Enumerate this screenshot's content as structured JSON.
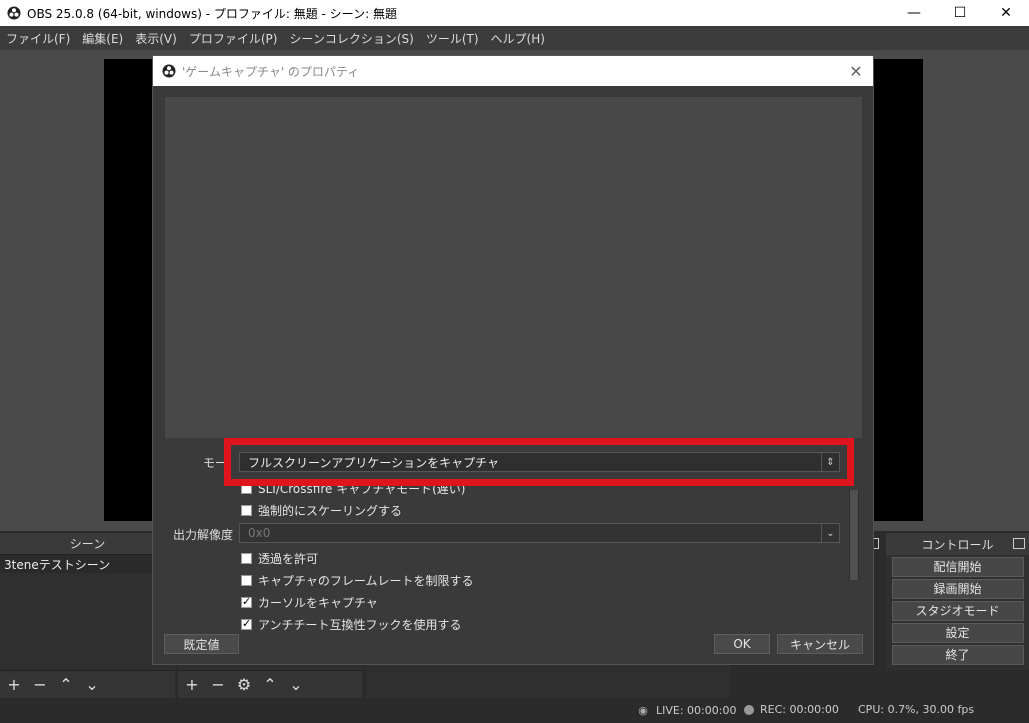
{
  "window": {
    "title": "OBS 25.0.8 (64-bit, windows) - プロファイル: 無題 - シーン: 無題",
    "minimize": "—",
    "maximize": "☐",
    "close": "✕"
  },
  "menu": [
    "ファイル(F)",
    "編集(E)",
    "表示(V)",
    "プロファイル(P)",
    "シーンコレクション(S)",
    "ツール(T)",
    "ヘルプ(H)"
  ],
  "scenes": {
    "header": "シーン",
    "items": [
      "3teneテストシーン"
    ]
  },
  "controls": {
    "header": "コントロール",
    "buttons": [
      "配信開始",
      "録画開始",
      "スタジオモード",
      "設定",
      "終了"
    ]
  },
  "status": {
    "live": "LIVE: 00:00:00",
    "rec": "REC: 00:00:00",
    "cpu": "CPU: 0.7%, 30.00 fps"
  },
  "dialog": {
    "title": "'ゲームキャプチャ' のプロパティ",
    "mode_label": "モー",
    "mode_value": "フルスクリーンアプリケーションをキャプチャ",
    "partial_option": "SLI/Crossfire キャプチャモード(遅い)",
    "force_scaling": "強制的にスケーリングする",
    "output_res_label": "出力解像度",
    "output_res_value": "0x0",
    "allow_transparency": "透過を許可",
    "limit_framerate": "キャプチャのフレームレートを制限する",
    "capture_cursor": "カーソルをキャプチャ",
    "anticheat_hook": "アンチチート互換性フックを使用する",
    "defaults_button": "既定値",
    "ok_button": "OK",
    "cancel_button": "キャンセル"
  },
  "colors": {
    "highlight": "#e0141e",
    "preview_bg": "#000000",
    "dialog_bg": "#3a3a3a"
  }
}
